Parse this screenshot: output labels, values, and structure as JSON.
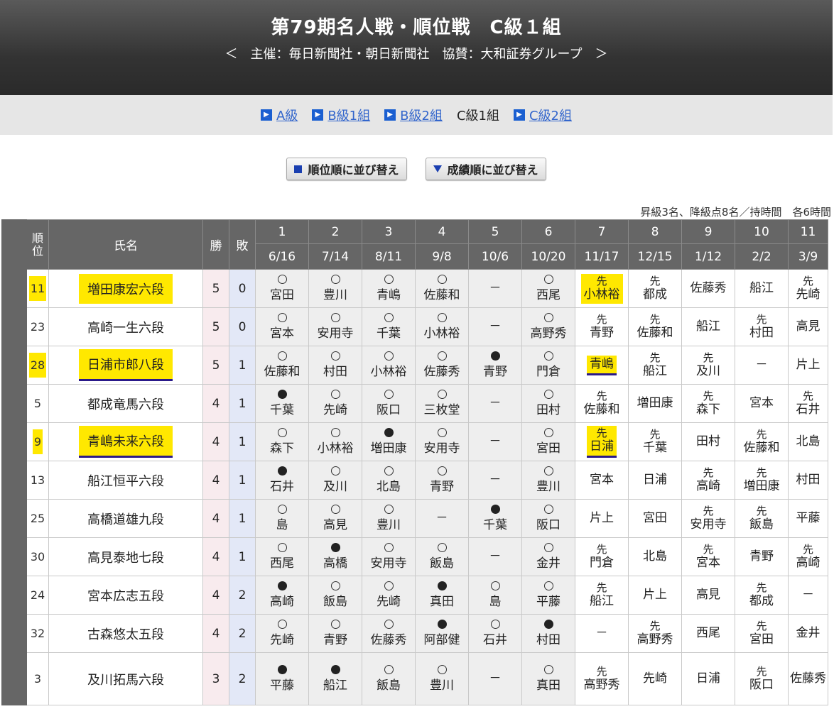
{
  "header": {
    "title": "第79期名人戦・順位戦　C級１組",
    "subtitle": "＜　主催：毎日新聞社・朝日新聞社　協賛：大和証券グループ　＞"
  },
  "nav": [
    {
      "label": "A級",
      "link": true
    },
    {
      "label": "B級1組",
      "link": true
    },
    {
      "label": "B級2組",
      "link": true
    },
    {
      "label": "C級1組",
      "link": false
    },
    {
      "label": "C級2組",
      "link": true
    }
  ],
  "sort": {
    "rank_button": "順位順に並び替え",
    "score_button": "成績順に並び替え"
  },
  "note": "昇級3名、降級点8名／持時間　各6時間",
  "table_headers": {
    "rank": "順位",
    "name": "氏名",
    "wins": "勝",
    "losses": "敗"
  },
  "rounds": [
    {
      "no": "1",
      "date": "6/16"
    },
    {
      "no": "2",
      "date": "7/14"
    },
    {
      "no": "3",
      "date": "8/11"
    },
    {
      "no": "4",
      "date": "9/8"
    },
    {
      "no": "5",
      "date": "10/6"
    },
    {
      "no": "6",
      "date": "10/20"
    },
    {
      "no": "7",
      "date": "11/17"
    },
    {
      "no": "8",
      "date": "12/15"
    },
    {
      "no": "9",
      "date": "1/12"
    },
    {
      "no": "10",
      "date": "2/2"
    },
    {
      "no": "11",
      "date": "3/9"
    }
  ],
  "legend_marks": {
    "win": "win-circle",
    "loss": "loss-circle",
    "sente": "先"
  },
  "highlight_color": "#ffe800",
  "players": [
    {
      "rank": "11",
      "name": "増田康宏六段",
      "wins": "5",
      "losses": "0",
      "hl": true,
      "ul": false,
      "results": [
        [
          "w",
          "宮田"
        ],
        [
          "w",
          "豊川"
        ],
        [
          "w",
          "青嶋"
        ],
        [
          "w",
          "佐藤和"
        ],
        [
          "",
          "－"
        ],
        [
          "w",
          "西尾"
        ],
        [
          "s",
          "小林裕",
          "hl"
        ],
        [
          "s",
          "都成"
        ],
        [
          "",
          "佐藤秀"
        ],
        [
          "",
          "船江"
        ],
        [
          "s",
          "先崎"
        ]
      ]
    },
    {
      "rank": "23",
      "name": "高崎一生六段",
      "wins": "5",
      "losses": "0",
      "hl": false,
      "ul": false,
      "results": [
        [
          "w",
          "宮本"
        ],
        [
          "w",
          "安用寺"
        ],
        [
          "w",
          "千葉"
        ],
        [
          "w",
          "小林裕"
        ],
        [
          "",
          "－"
        ],
        [
          "w",
          "高野秀"
        ],
        [
          "s",
          "青野"
        ],
        [
          "s",
          "佐藤和"
        ],
        [
          "",
          "船江"
        ],
        [
          "s",
          "村田"
        ],
        [
          "",
          "高見"
        ]
      ]
    },
    {
      "rank": "28",
      "name": "日浦市郎八段",
      "wins": "5",
      "losses": "1",
      "hl": true,
      "ul": true,
      "results": [
        [
          "w",
          "佐藤和"
        ],
        [
          "w",
          "村田"
        ],
        [
          "w",
          "小林裕"
        ],
        [
          "w",
          "佐藤秀"
        ],
        [
          "b",
          "青野"
        ],
        [
          "w",
          "門倉"
        ],
        [
          "",
          "青嶋",
          "hlul"
        ],
        [
          "s",
          "船江"
        ],
        [
          "s",
          "及川"
        ],
        [
          "",
          "－"
        ],
        [
          "",
          "片上"
        ]
      ]
    },
    {
      "rank": "5",
      "name": "都成竜馬六段",
      "wins": "4",
      "losses": "1",
      "hl": false,
      "ul": false,
      "results": [
        [
          "b",
          "千葉"
        ],
        [
          "w",
          "先崎"
        ],
        [
          "w",
          "阪口"
        ],
        [
          "w",
          "三枚堂"
        ],
        [
          "",
          "－"
        ],
        [
          "w",
          "田村"
        ],
        [
          "s",
          "佐藤和"
        ],
        [
          "",
          "増田康"
        ],
        [
          "s",
          "森下"
        ],
        [
          "",
          "宮本"
        ],
        [
          "s",
          "石井"
        ]
      ]
    },
    {
      "rank": "9",
      "name": "青嶋未来六段",
      "wins": "4",
      "losses": "1",
      "hl": true,
      "ul": true,
      "results": [
        [
          "w",
          "森下"
        ],
        [
          "w",
          "小林裕"
        ],
        [
          "b",
          "増田康"
        ],
        [
          "w",
          "安用寺"
        ],
        [
          "",
          "－"
        ],
        [
          "w",
          "宮田"
        ],
        [
          "s",
          "日浦",
          "hlul"
        ],
        [
          "s",
          "千葉"
        ],
        [
          "",
          "田村"
        ],
        [
          "s",
          "佐藤和"
        ],
        [
          "",
          "北島"
        ]
      ]
    },
    {
      "rank": "13",
      "name": "船江恒平六段",
      "wins": "4",
      "losses": "1",
      "hl": false,
      "ul": false,
      "results": [
        [
          "b",
          "石井"
        ],
        [
          "w",
          "及川"
        ],
        [
          "w",
          "北島"
        ],
        [
          "w",
          "青野"
        ],
        [
          "",
          "－"
        ],
        [
          "w",
          "豊川"
        ],
        [
          "",
          "宮本"
        ],
        [
          "",
          "日浦"
        ],
        [
          "s",
          "高崎"
        ],
        [
          "s",
          "増田康"
        ],
        [
          "",
          "村田"
        ]
      ]
    },
    {
      "rank": "25",
      "name": "高橋道雄九段",
      "wins": "4",
      "losses": "1",
      "hl": false,
      "ul": false,
      "results": [
        [
          "w",
          "島"
        ],
        [
          "w",
          "高見"
        ],
        [
          "w",
          "豊川"
        ],
        [
          "",
          "－"
        ],
        [
          "b",
          "千葉"
        ],
        [
          "w",
          "阪口"
        ],
        [
          "",
          "片上"
        ],
        [
          "",
          "宮田"
        ],
        [
          "s",
          "安用寺"
        ],
        [
          "s",
          "飯島"
        ],
        [
          "",
          "平藤"
        ]
      ]
    },
    {
      "rank": "30",
      "name": "高見泰地七段",
      "wins": "4",
      "losses": "1",
      "hl": false,
      "ul": false,
      "results": [
        [
          "w",
          "西尾"
        ],
        [
          "b",
          "高橋"
        ],
        [
          "w",
          "安用寺"
        ],
        [
          "w",
          "飯島"
        ],
        [
          "",
          "－"
        ],
        [
          "w",
          "金井"
        ],
        [
          "s",
          "門倉"
        ],
        [
          "",
          "北島"
        ],
        [
          "s",
          "宮本"
        ],
        [
          "",
          "青野"
        ],
        [
          "s",
          "高崎"
        ]
      ]
    },
    {
      "rank": "24",
      "name": "宮本広志五段",
      "wins": "4",
      "losses": "2",
      "hl": false,
      "ul": false,
      "results": [
        [
          "b",
          "高崎"
        ],
        [
          "w",
          "飯島"
        ],
        [
          "w",
          "先崎"
        ],
        [
          "b",
          "真田"
        ],
        [
          "w",
          "島"
        ],
        [
          "w",
          "平藤"
        ],
        [
          "s",
          "船江"
        ],
        [
          "",
          "片上"
        ],
        [
          "",
          "高見"
        ],
        [
          "s",
          "都成"
        ],
        [
          "",
          "－"
        ]
      ]
    },
    {
      "rank": "32",
      "name": "古森悠太五段",
      "wins": "4",
      "losses": "2",
      "hl": false,
      "ul": false,
      "results": [
        [
          "w",
          "先崎"
        ],
        [
          "w",
          "青野"
        ],
        [
          "w",
          "佐藤秀"
        ],
        [
          "b",
          "阿部健"
        ],
        [
          "w",
          "石井"
        ],
        [
          "b",
          "村田"
        ],
        [
          "",
          "－"
        ],
        [
          "s",
          "高野秀"
        ],
        [
          "",
          "西尾"
        ],
        [
          "s",
          "宮田"
        ],
        [
          "",
          "金井"
        ]
      ]
    },
    {
      "rank": "3",
      "name": "及川拓馬六段",
      "wins": "3",
      "losses": "2",
      "hl": false,
      "ul": false,
      "results": [
        [
          "b",
          "平藤"
        ],
        [
          "b",
          "船江"
        ],
        [
          "w",
          "飯島"
        ],
        [
          "w",
          "豊川"
        ],
        [
          "",
          "－"
        ],
        [
          "w",
          "真田"
        ],
        [
          "s",
          "高野秀"
        ],
        [
          "",
          "先崎"
        ],
        [
          "",
          "日浦"
        ],
        [
          "s",
          "阪口"
        ],
        [
          "",
          "佐藤秀"
        ]
      ]
    }
  ]
}
